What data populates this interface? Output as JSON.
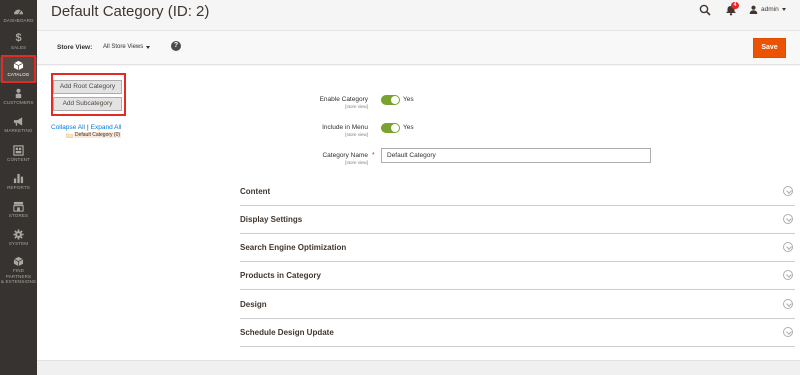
{
  "sidebar": {
    "items": [
      {
        "label": "DASHBOARD",
        "icon": "dashboard-icon"
      },
      {
        "label": "SALES",
        "icon": "dollar-icon"
      },
      {
        "label": "CATALOG",
        "icon": "cube-icon",
        "active": true
      },
      {
        "label": "CUSTOMERS",
        "icon": "person-icon"
      },
      {
        "label": "MARKETING",
        "icon": "megaphone-icon"
      },
      {
        "label": "CONTENT",
        "icon": "content-grid-icon"
      },
      {
        "label": "REPORTS",
        "icon": "bar-chart-icon"
      },
      {
        "label": "STORES",
        "icon": "storefront-icon"
      },
      {
        "label": "SYSTEM",
        "icon": "gear-icon"
      },
      {
        "label": "FIND PARTNERS",
        "label2": "& EXTENSIONS",
        "icon": "partners-cube-icon"
      }
    ]
  },
  "header": {
    "title": "Default Category (ID: 2)",
    "notification_count": "4",
    "user_name": "admin"
  },
  "store_bar": {
    "label": "Store View:",
    "selected": "All Store Views",
    "help_icon_text": "?",
    "save_label": "Save"
  },
  "tree": {
    "add_root_label": "Add Root Category",
    "add_sub_label": "Add Subcategory",
    "collapse_all": "Collapse All",
    "separator": "|",
    "expand_all": "Expand All",
    "node_label": "Default Category (0)"
  },
  "form": {
    "enable_category": {
      "label": "Enable Category",
      "scope": "[store view]",
      "value": "Yes"
    },
    "include_in_menu": {
      "label": "Include in Menu",
      "scope": "[store view]",
      "value": "Yes"
    },
    "category_name": {
      "label": "Category Name",
      "scope": "[store view]",
      "required_mark": "*",
      "value": "Default Category"
    }
  },
  "sections": [
    {
      "title": "Content"
    },
    {
      "title": "Display Settings"
    },
    {
      "title": "Search Engine Optimization"
    },
    {
      "title": "Products in Category"
    },
    {
      "title": "Design"
    },
    {
      "title": "Schedule Design Update"
    }
  ],
  "colors": {
    "sidebar_bg": "#373330",
    "accent_orange": "#eb5202",
    "toggle_green": "#79a22e",
    "highlight_red": "#e02b27",
    "link_blue": "#007bdb"
  }
}
